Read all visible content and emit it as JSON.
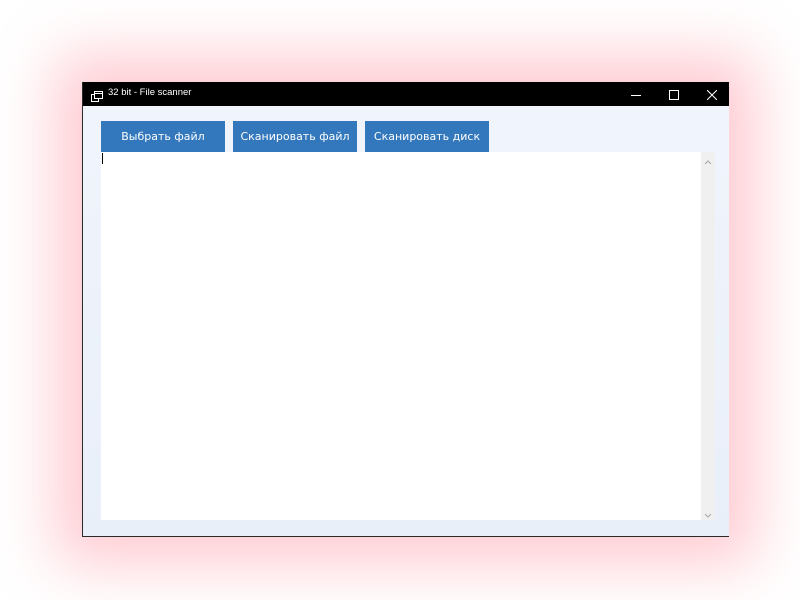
{
  "window": {
    "title": "32 bit - File scanner"
  },
  "toolbar": {
    "select_file_label": "Выбрать файл",
    "scan_file_label": "Сканировать файл",
    "scan_disk_label": "Сканировать диск"
  },
  "output": {
    "text": ""
  },
  "colors": {
    "button_bg": "#3378bc",
    "titlebar_bg": "#000000",
    "window_bg": "#eef2fa"
  },
  "icons": {
    "app": "window-icon",
    "minimize": "minimize-icon",
    "maximize": "maximize-icon",
    "close": "close-icon",
    "scroll_up": "chevron-up-icon",
    "scroll_down": "chevron-down-icon"
  }
}
